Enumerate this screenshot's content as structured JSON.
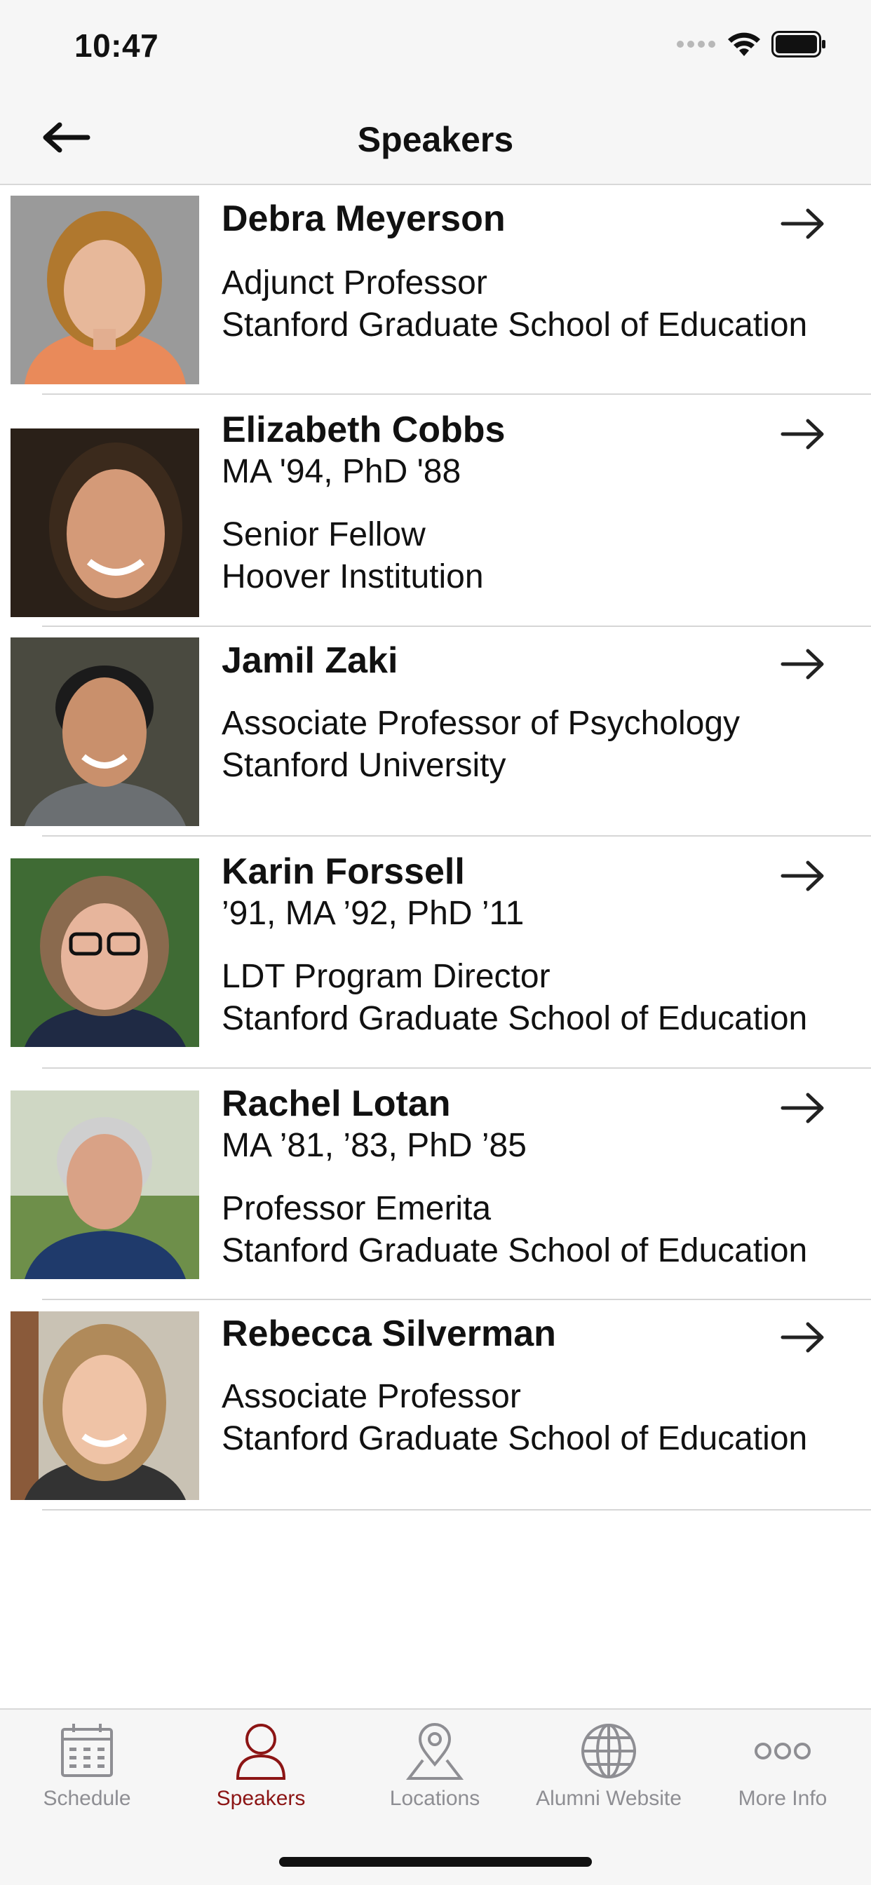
{
  "status_bar": {
    "time": "10:47"
  },
  "header": {
    "title": "Speakers"
  },
  "speakers": [
    {
      "name": "Debra Meyerson",
      "degrees": "",
      "title": "Adjunct Professor",
      "org": "Stanford Graduate School of Education"
    },
    {
      "name": "Elizabeth Cobbs",
      "degrees": "MA '94, PhD '88",
      "title": "Senior Fellow",
      "org": "Hoover Institution"
    },
    {
      "name": "Jamil Zaki",
      "degrees": "",
      "title": "Associate Professor of Psychology",
      "org": "Stanford University"
    },
    {
      "name": "Karin Forssell",
      "degrees": "’91, MA ’92, PhD ’11",
      "title": "LDT Program Director",
      "org": "Stanford Graduate School of Education"
    },
    {
      "name": "Rachel Lotan",
      "degrees": "MA ’81, ’83, PhD ’85",
      "title": "Professor Emerita",
      "org": "Stanford Graduate School of Education"
    },
    {
      "name": "Rebecca Silverman",
      "degrees": "",
      "title": "Associate Professor",
      "org": "Stanford Graduate School of Education"
    }
  ],
  "tabs": [
    {
      "label": "Schedule",
      "icon": "calendar-icon",
      "active": false
    },
    {
      "label": "Speakers",
      "icon": "person-icon",
      "active": true
    },
    {
      "label": "Locations",
      "icon": "map-pin-icon",
      "active": false
    },
    {
      "label": "Alumni Website",
      "icon": "globe-icon",
      "active": false
    },
    {
      "label": "More Info",
      "icon": "more-icon",
      "active": false
    }
  ],
  "colors": {
    "accent": "#8c1515",
    "inactive": "#8e8e93"
  }
}
